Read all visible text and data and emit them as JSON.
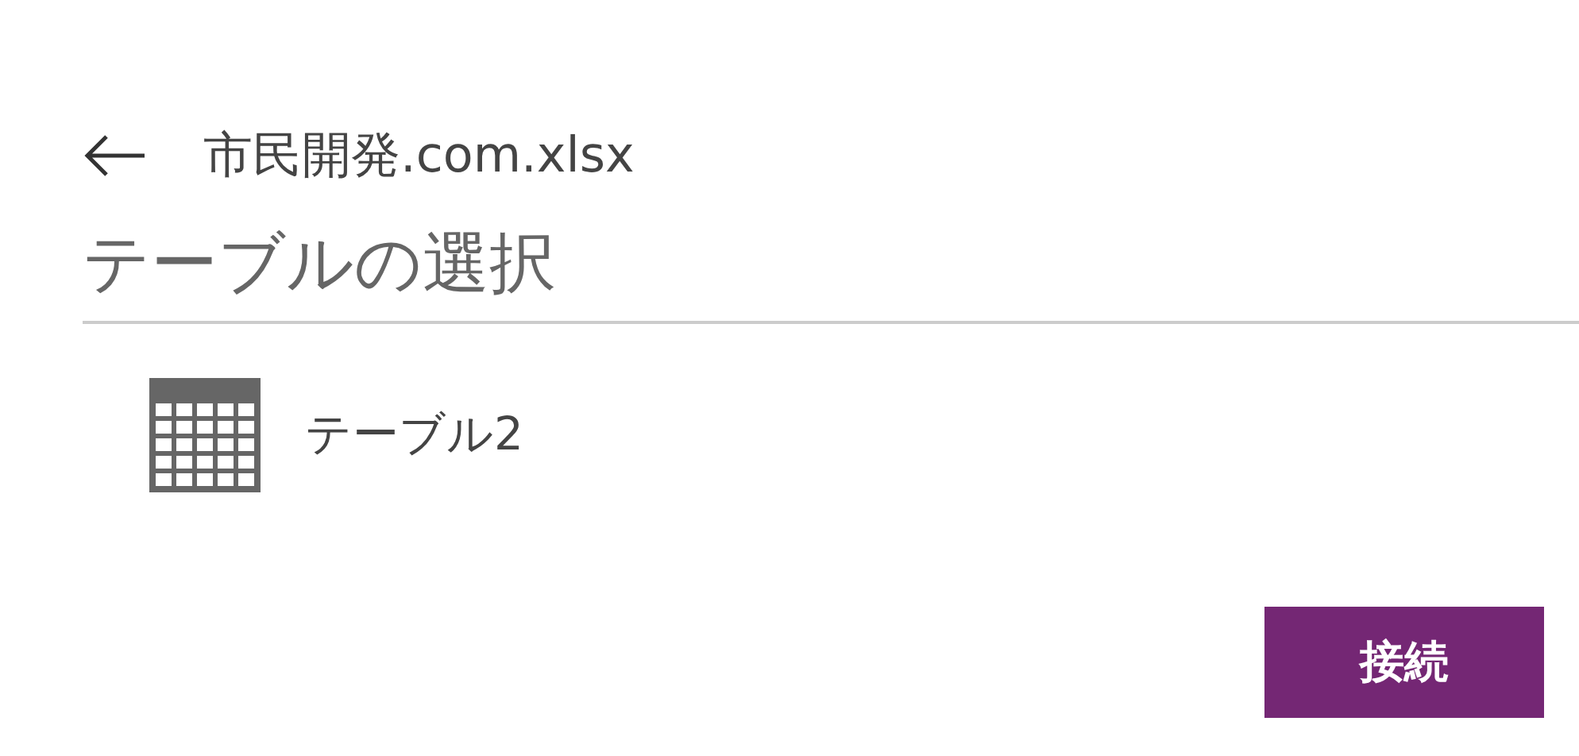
{
  "header": {
    "file_name": "市民開発.com.xlsx"
  },
  "heading": "テーブルの選択",
  "tables": [
    {
      "name": "テーブル2"
    }
  ],
  "buttons": [
    {
      "label": "接続"
    }
  ]
}
